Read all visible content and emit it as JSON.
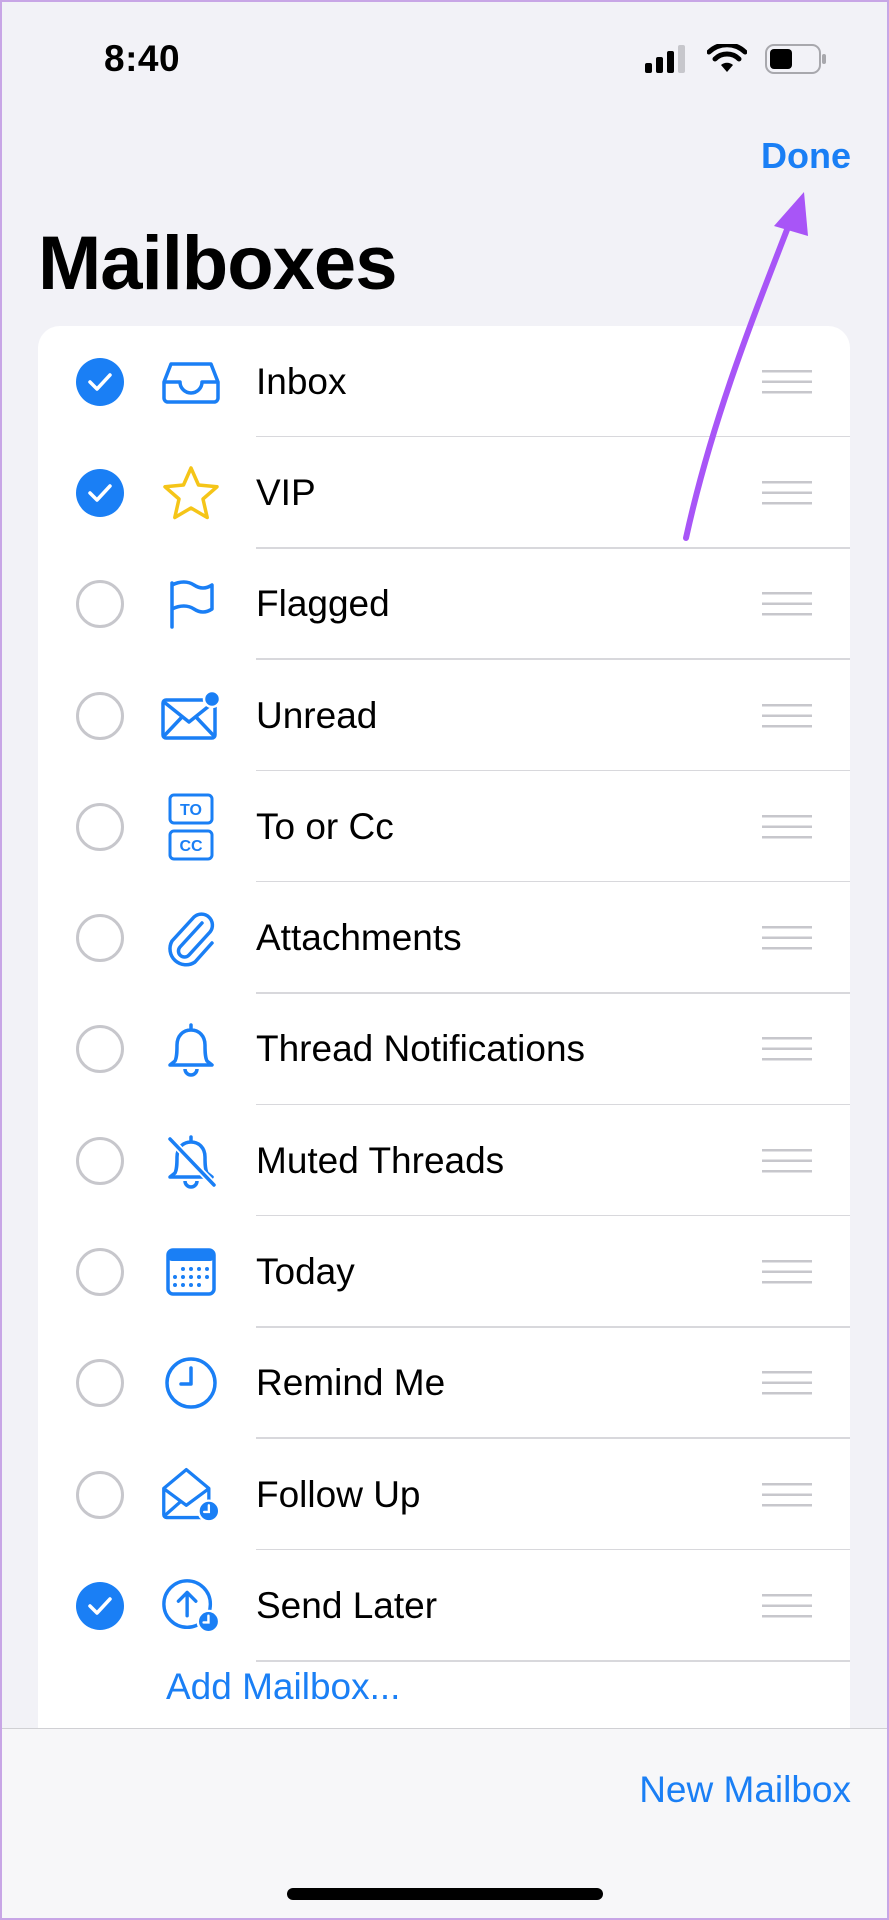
{
  "status_bar": {
    "time": "8:40"
  },
  "header": {
    "done_label": "Done",
    "title": "Mailboxes"
  },
  "mailboxes": [
    {
      "label": "Inbox",
      "checked": true,
      "icon": "inbox-tray-icon"
    },
    {
      "label": "VIP",
      "checked": true,
      "icon": "star-icon"
    },
    {
      "label": "Flagged",
      "checked": false,
      "icon": "flag-icon"
    },
    {
      "label": "Unread",
      "checked": false,
      "icon": "unread-envelope-icon"
    },
    {
      "label": "To or Cc",
      "checked": false,
      "icon": "to-cc-icon"
    },
    {
      "label": "Attachments",
      "checked": false,
      "icon": "paperclip-icon"
    },
    {
      "label": "Thread Notifications",
      "checked": false,
      "icon": "bell-icon"
    },
    {
      "label": "Muted Threads",
      "checked": false,
      "icon": "bell-slash-icon"
    },
    {
      "label": "Today",
      "checked": false,
      "icon": "calendar-icon"
    },
    {
      "label": "Remind Me",
      "checked": false,
      "icon": "clock-icon"
    },
    {
      "label": "Follow Up",
      "checked": false,
      "icon": "envelope-clock-icon"
    },
    {
      "label": "Send Later",
      "checked": true,
      "icon": "send-later-icon"
    }
  ],
  "add_mailbox_label": "Add Mailbox...",
  "toolbar": {
    "new_mailbox_label": "New Mailbox"
  },
  "colors": {
    "accent": "#1a7ff5",
    "star": "#f5c518",
    "annotation_arrow": "#a855f7",
    "background": "#f2f2f7"
  }
}
